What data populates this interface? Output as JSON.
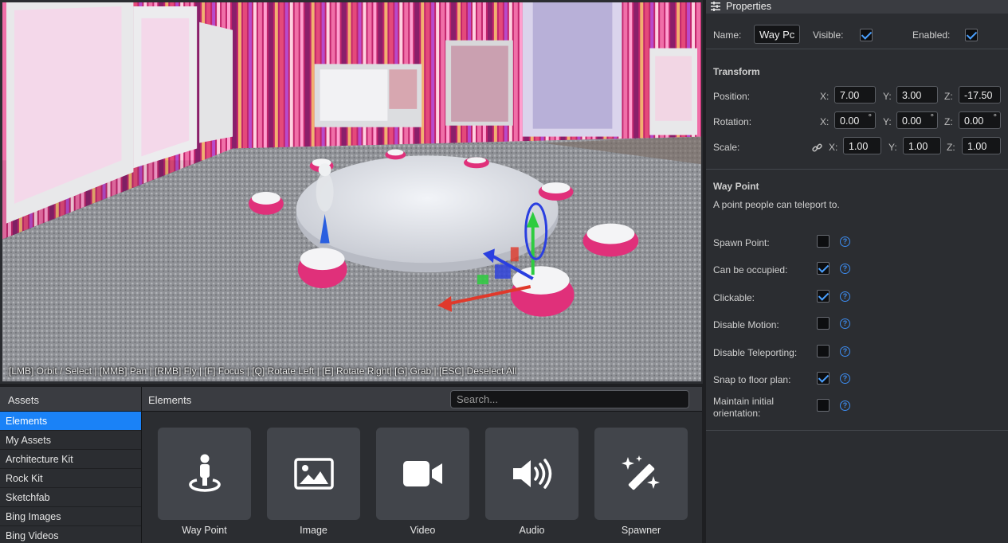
{
  "viewport": {
    "hint": "[LMB] Orbit / Select | [MMB] Pan | [RMB] Fly | [F] Focus | [Q] Rotate Left | [E] Rotate Right| [G] Grab | [ESC] Deselect All"
  },
  "assets": {
    "title": "Assets",
    "items": [
      {
        "label": "Elements",
        "active": true
      },
      {
        "label": "My Assets"
      },
      {
        "label": "Architecture Kit"
      },
      {
        "label": "Rock Kit"
      },
      {
        "label": "Sketchfab"
      },
      {
        "label": "Bing Images"
      },
      {
        "label": "Bing Videos"
      }
    ]
  },
  "elements": {
    "title": "Elements",
    "search_placeholder": "Search...",
    "tiles": [
      {
        "label": "Way Point",
        "icon": "waypoint-person-icon"
      },
      {
        "label": "Image",
        "icon": "image-icon"
      },
      {
        "label": "Video",
        "icon": "video-camera-icon"
      },
      {
        "label": "Audio",
        "icon": "speaker-icon"
      },
      {
        "label": "Spawner",
        "icon": "magic-wand-icon"
      }
    ]
  },
  "properties": {
    "title": "Properties",
    "name_label": "Name:",
    "name_value": "Way Pc",
    "visible_label": "Visible:",
    "visible": true,
    "enabled_label": "Enabled:",
    "enabled": true,
    "transform": {
      "title": "Transform",
      "position_label": "Position:",
      "rotation_label": "Rotation:",
      "scale_label": "Scale:",
      "x_label": "X:",
      "y_label": "Y:",
      "z_label": "Z:",
      "degree_symbol": "°",
      "position": {
        "x": "7.00",
        "y": "3.00",
        "z": "-17.50"
      },
      "rotation": {
        "x": "0.00",
        "y": "0.00",
        "z": "0.00"
      },
      "scale": {
        "x": "1.00",
        "y": "1.00",
        "z": "1.00"
      }
    },
    "waypoint": {
      "title": "Way Point",
      "description": "A point people can teleport to.",
      "help_glyph": "?",
      "options": [
        {
          "label": "Spawn Point:",
          "checked": false
        },
        {
          "label": "Can be occupied:",
          "checked": true
        },
        {
          "label": "Clickable:",
          "checked": true
        },
        {
          "label": "Disable Motion:",
          "checked": false
        },
        {
          "label": "Disable Teleporting:",
          "checked": false
        },
        {
          "label": "Snap to floor plan:",
          "checked": true
        },
        {
          "label": "Maintain initial orientation:",
          "checked": false
        }
      ]
    }
  },
  "colors": {
    "accent": "#1a82f7",
    "panel": "#2b2d31",
    "header": "#3a3c41",
    "check": "#4aa0ff",
    "seat_pink": "#e0307a",
    "gizmo_green": "#2ecc40",
    "gizmo_blue": "#2a3fe0",
    "gizmo_red": "#e0392b"
  }
}
